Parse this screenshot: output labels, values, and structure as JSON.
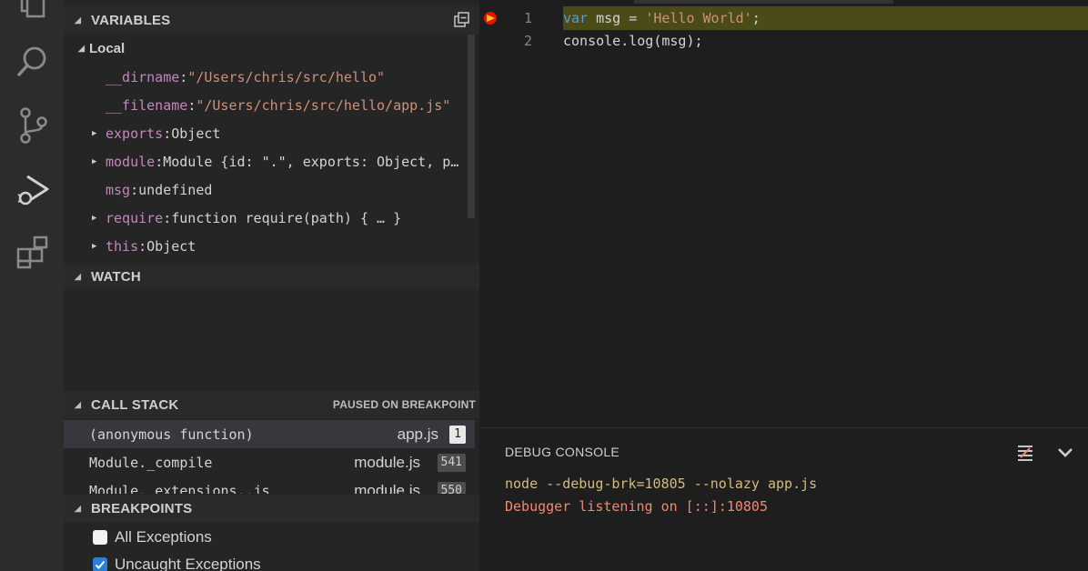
{
  "activity_bar": {
    "icons": [
      "explorer-icon",
      "search-icon",
      "source-control-icon",
      "debug-icon",
      "extensions-icon"
    ]
  },
  "variables": {
    "header": "VARIABLES",
    "scope": "Local",
    "items": [
      {
        "name": "__dirname",
        "sep": ": ",
        "value": "\"/Users/chris/src/hello\""
      },
      {
        "name": "__filename",
        "sep": ": ",
        "value": "\"/Users/chris/src/hello/app.js\""
      },
      {
        "name": "exports",
        "sep": ": ",
        "value": "Object"
      },
      {
        "name": "module",
        "sep": ": ",
        "value": "Module {id: \".\", exports: Object, p…"
      },
      {
        "name": "msg",
        "sep": ": ",
        "value": "undefined"
      },
      {
        "name": "require",
        "sep": ": ",
        "value": "function require(path) { … }"
      },
      {
        "name": "this",
        "sep": ": ",
        "value": "Object"
      }
    ]
  },
  "watch": {
    "header": "WATCH"
  },
  "call_stack": {
    "header": "CALL STACK",
    "status": "PAUSED ON BREAKPOINT",
    "frames": [
      {
        "function": "(anonymous function)",
        "file": "app.js",
        "line": "1"
      },
      {
        "function": "Module._compile",
        "file": "module.js",
        "line": "541"
      },
      {
        "function": "Module._extensions..js",
        "file": "module.js",
        "line": "550"
      }
    ]
  },
  "breakpoints": {
    "header": "BREAKPOINTS",
    "items": [
      {
        "label": "All Exceptions",
        "checked": false
      },
      {
        "label": "Uncaught Exceptions",
        "checked": true
      }
    ]
  },
  "editor": {
    "lines": [
      {
        "number": "1",
        "keyword": "var",
        "ident": " msg = ",
        "string": "'Hello World'",
        "rest": ";"
      },
      {
        "number": "2",
        "keyword": "",
        "ident": "console.log(msg);",
        "string": "",
        "rest": ""
      }
    ]
  },
  "debug_console": {
    "title": "DEBUG CONSOLE",
    "output": [
      "node --debug-brk=10805 --nolazy app.js",
      "Debugger listening on [::]:10805"
    ],
    "output_color": "#d7ba7d",
    "error_color": "#f48771"
  },
  "colors": {
    "current_line_highlight": "#4b4b18",
    "breakpoint": "#e51400",
    "execution_pointer": "#ffcc00"
  }
}
